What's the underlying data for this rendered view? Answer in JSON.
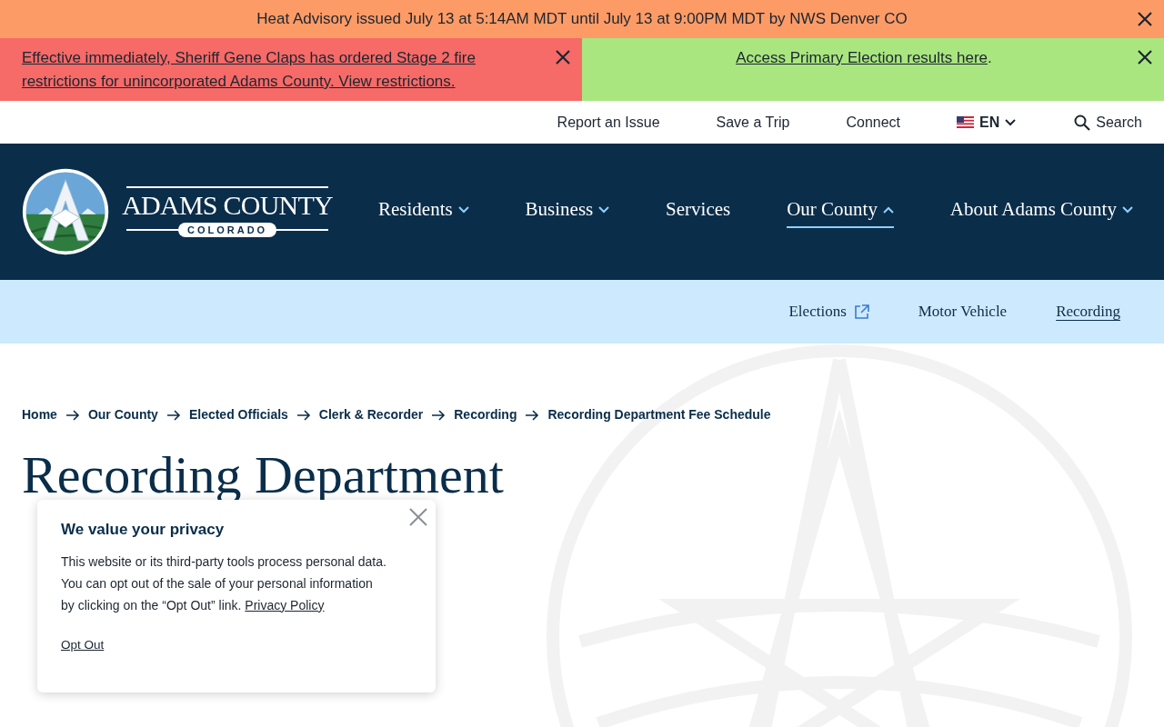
{
  "alerts_top": {
    "text": "Heat Advisory issued July 13 at 5:14AM MDT until July 13 at 9:00PM MDT by NWS Denver CO"
  },
  "alerts": [
    {
      "text": "Effective immediately, Sheriff Gene Claps has ordered Stage 2 fire restrictions for unincorporated Adams County. View restrictions.",
      "color": "#f66a67"
    },
    {
      "text": "Access Primary Election results here",
      "suffix": ".",
      "color": "#a9e67f"
    }
  ],
  "utility_nav": [
    "Report an Issue",
    "Save a Trip",
    "Connect"
  ],
  "language": "EN",
  "search": "Search",
  "logo": {
    "name": "ADAMS COUNTY",
    "state": "COLORADO"
  },
  "main_nav": [
    {
      "label": "Residents",
      "expanded": false,
      "selected": false
    },
    {
      "label": "Business",
      "expanded": false,
      "selected": false
    },
    {
      "label": "Services",
      "selected": false
    },
    {
      "label": "Our County",
      "expanded": true,
      "selected": true
    },
    {
      "label": "About Adams County",
      "expanded": false,
      "selected": false
    }
  ],
  "sub_nav": [
    {
      "label": "Elections",
      "external": true,
      "selected": false
    },
    {
      "label": "Motor Vehicle",
      "external": false,
      "selected": false
    },
    {
      "label": "Recording",
      "external": false,
      "selected": true
    }
  ],
  "breadcrumb": [
    "Home",
    "Our County",
    "Elected Officials",
    "Clerk & Recorder",
    "Recording",
    "Recording Department Fee Schedule"
  ],
  "heading_lines": [
    "Recording Department"
  ],
  "privacy_dialog": {
    "title": "We value your privacy",
    "body": "This website or its third-party tools process personal data. You can opt out of the sale of your personal information by clicking on the “Opt Out” link.",
    "policy_link": "Privacy Policy",
    "opt_out": "Opt Out"
  }
}
